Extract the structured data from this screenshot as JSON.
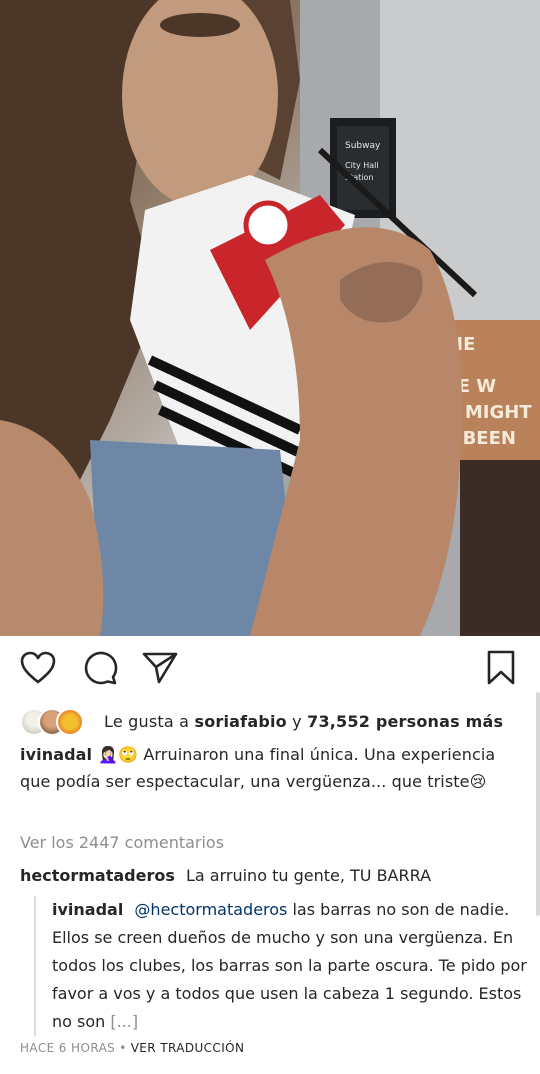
{
  "post": {
    "sign_text": [
      "Subway",
      "City Hall",
      "Station"
    ],
    "poster_text": [
      "NE",
      "BE W",
      "U MIGHT",
      "E BEEN"
    ]
  },
  "actions": {
    "like_icon": "heart-icon",
    "comment_icon": "comment-icon",
    "share_icon": "send-icon",
    "save_icon": "bookmark-icon"
  },
  "likes": {
    "prefix": "Le gusta a",
    "user": "soriafabio",
    "connector": "y",
    "count": "73,552 personas más"
  },
  "caption": {
    "username": "ivinadal",
    "emoji": "🤦🏻‍♀️🙄",
    "text": "Arruinaron una final única. Una experiencia que podía ser espectacular, una vergüenza... que triste😢"
  },
  "view_all_comments": "Ver los 2447 comentarios",
  "comment1": {
    "username": "hectormataderos",
    "text": "La arruino tu gente, TU BARRA"
  },
  "reply": {
    "username": "ivinadal",
    "mention": "@hectormataderos",
    "text": "las barras no son de nadie. Ellos se creen dueños de mucho y son una vergüenza. En todos los clubes, los barras son la parte oscura. Te pido por favor a vos y a todos que usen la cabeza 1 segundo. Estos no son",
    "more": "[...]"
  },
  "meta": {
    "time": "HACE 6 HORAS",
    "separator": "•",
    "translate": "VER TRADUCCIÓN"
  }
}
